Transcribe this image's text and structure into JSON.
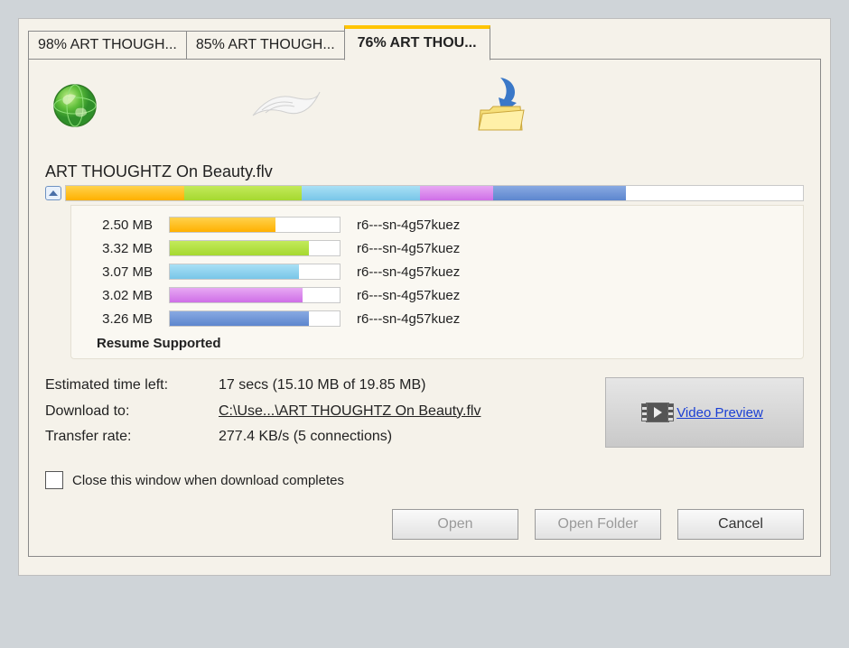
{
  "tabs": [
    {
      "label": "98% ART THOUGH...",
      "active": false
    },
    {
      "label": "85% ART THOUGH...",
      "active": false
    },
    {
      "label": "76% ART THOU...",
      "active": true
    }
  ],
  "file": {
    "name": "ART THOUGHTZ On Beauty.flv"
  },
  "overall": {
    "segments_pct": [
      16,
      16,
      16,
      10,
      18
    ],
    "colors": [
      "o",
      "g",
      "c",
      "m",
      "b"
    ]
  },
  "segments": [
    {
      "size": "2.50 MB",
      "pct": 62,
      "color": "o",
      "host": "r6---sn-4g57kuez"
    },
    {
      "size": "3.32 MB",
      "pct": 82,
      "color": "g",
      "host": "r6---sn-4g57kuez"
    },
    {
      "size": "3.07 MB",
      "pct": 76,
      "color": "c",
      "host": "r6---sn-4g57kuez"
    },
    {
      "size": "3.02 MB",
      "pct": 78,
      "color": "m",
      "host": "r6---sn-4g57kuez"
    },
    {
      "size": "3.26 MB",
      "pct": 82,
      "color": "b",
      "host": "r6---sn-4g57kuez"
    }
  ],
  "resume_label": "Resume Supported",
  "info": {
    "eta_label": "Estimated time left:",
    "eta_value": "17 secs (15.10 MB of 19.85 MB)",
    "dest_label": "Download to:",
    "dest_value": "C:\\Use...\\ART THOUGHTZ On Beauty.flv",
    "rate_label": "Transfer rate:",
    "rate_value": "277.4 KB/s (5 connections)"
  },
  "preview_link": "Video Preview",
  "checkbox_label": "Close this window when download completes",
  "buttons": {
    "open": "Open",
    "open_folder": "Open Folder",
    "cancel": "Cancel"
  }
}
